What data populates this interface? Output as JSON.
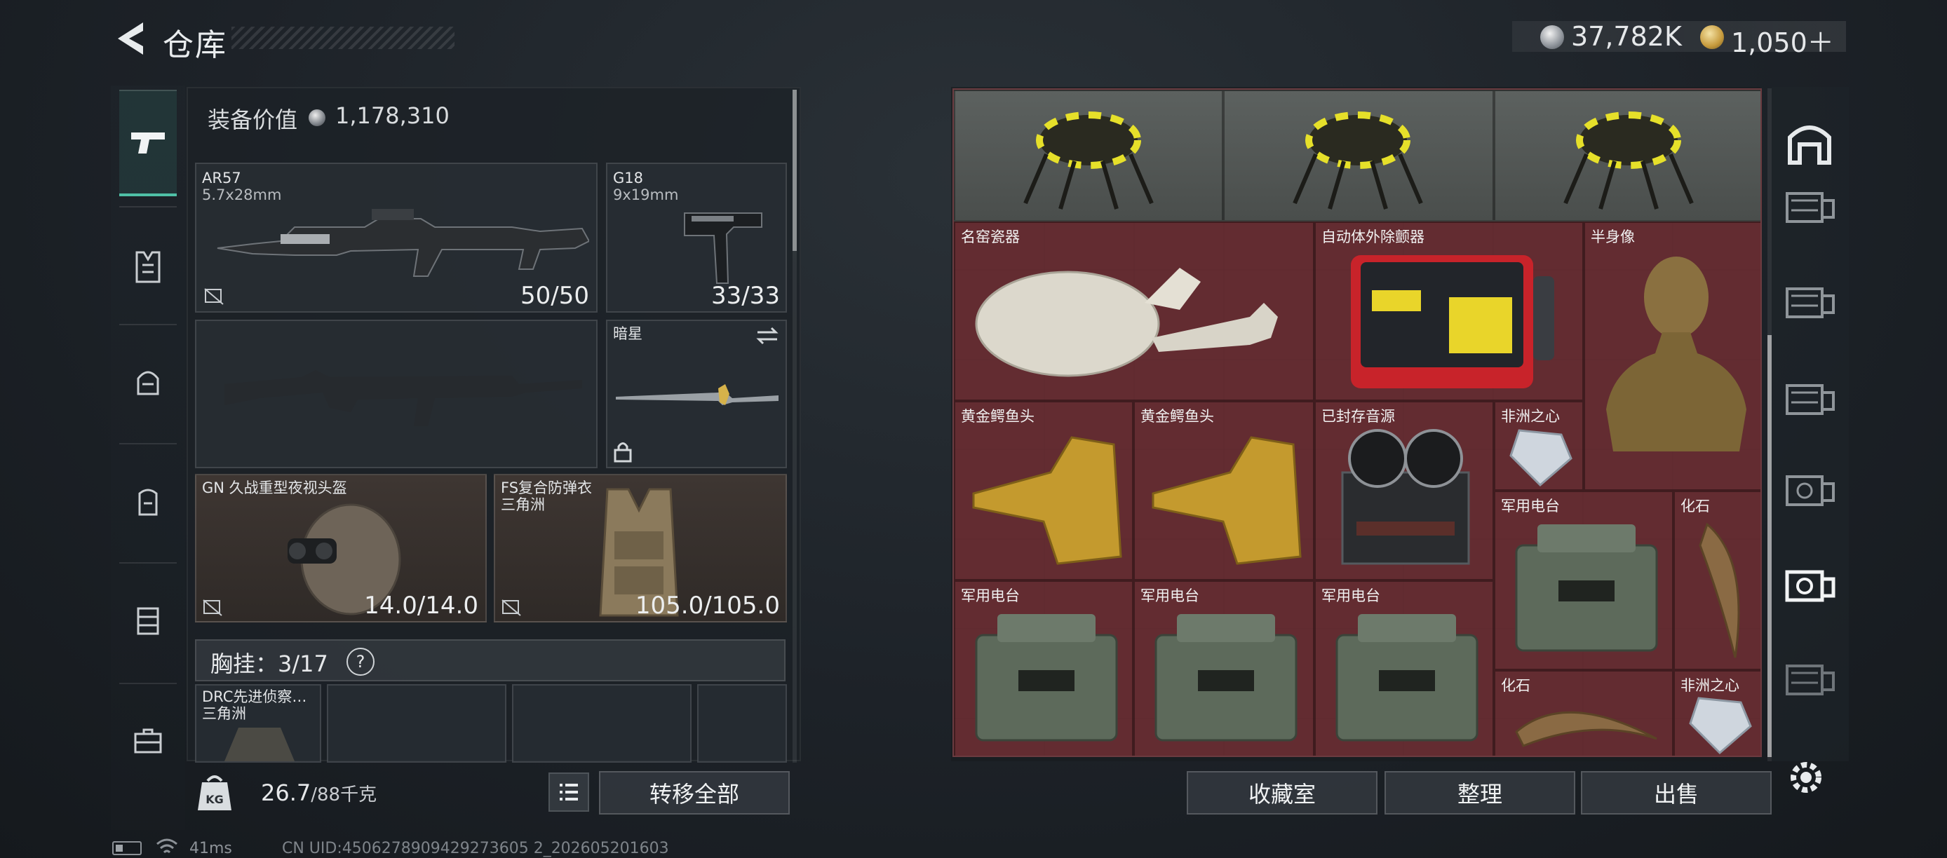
{
  "header": {
    "title": "仓库"
  },
  "currency": {
    "silver": "37,782K",
    "gold": "1,050＋"
  },
  "equipment": {
    "value_label": "装备价值",
    "value": "1,178,310",
    "slots": {
      "primary": {
        "name": "AR57",
        "caliber": "5.7x28mm",
        "ammo": "50/50"
      },
      "secondary": {
        "name": "G18",
        "caliber": "9x19mm",
        "ammo": "33/33"
      },
      "melee": {
        "name": "暗星"
      },
      "helmet": {
        "name": "GN 久战重型夜视头盔",
        "durability": "14.0/14.0"
      },
      "armor": {
        "name": "FS复合防弹衣",
        "sub": "三角洲",
        "durability": "105.0/105.0"
      }
    },
    "chest_rig": {
      "label": "胸挂：",
      "count": "3/17",
      "help": "?",
      "item_name": "DRC先进侦察…",
      "item_sub": "三角洲"
    },
    "weight": {
      "current": "26.7",
      "max_unit": "/88千克"
    },
    "transfer_all": "转移全部"
  },
  "stash": {
    "items": [
      {
        "label": ""
      },
      {
        "label": ""
      },
      {
        "label": ""
      },
      {
        "label": "名窑瓷器"
      },
      {
        "label": "自动体外除颤器"
      },
      {
        "label": "半身像"
      },
      {
        "label": "黄金鳄鱼头"
      },
      {
        "label": "黄金鳄鱼头"
      },
      {
        "label": "已封存音源"
      },
      {
        "label": "非洲之心"
      },
      {
        "label": "军用电台"
      },
      {
        "label": "化石"
      },
      {
        "label": "军用电台"
      },
      {
        "label": "军用电台"
      },
      {
        "label": "军用电台"
      },
      {
        "label": "化石"
      },
      {
        "label": "非洲之心"
      }
    ],
    "buttons": {
      "collection": "收藏室",
      "sort": "整理",
      "sell": "出售"
    }
  },
  "footer": {
    "ping": "41ms",
    "uid": "CN UID:4506278909429273605 2_202605201603"
  },
  "colors": {
    "accent": "#4fc0a6",
    "stash_bg": "#5e2b30"
  }
}
